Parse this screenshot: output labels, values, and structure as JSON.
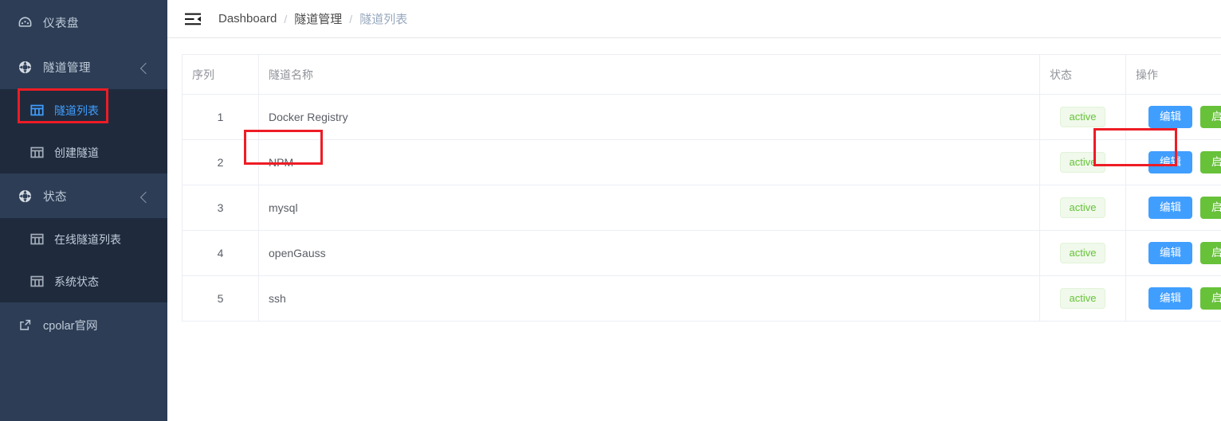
{
  "sidebar": {
    "items": [
      {
        "label": "仪表盘",
        "icon": "dashboard-gauge-icon",
        "type": "item"
      },
      {
        "label": "隧道管理",
        "icon": "tunnel-ring-icon",
        "type": "group",
        "arrow": "chevron-up-icon"
      },
      {
        "label": "隧道列表",
        "icon": "grid-table-icon",
        "type": "sub",
        "active": true
      },
      {
        "label": "创建隧道",
        "icon": "grid-table-icon",
        "type": "sub",
        "active": false
      },
      {
        "label": "状态",
        "icon": "tunnel-ring-icon",
        "type": "group",
        "arrow": "chevron-up-icon"
      },
      {
        "label": "在线隧道列表",
        "icon": "grid-table-icon",
        "type": "sub",
        "active": false
      },
      {
        "label": "系统状态",
        "icon": "grid-table-icon",
        "type": "sub",
        "active": false
      }
    ],
    "footer": {
      "label": "cpolar官网",
      "icon": "external-link-icon"
    },
    "colors": {
      "background": "#2d3d55",
      "submenu_background": "#1f2b3d",
      "text": "#bfcbd9",
      "active_text": "#409eff"
    }
  },
  "topbar": {
    "fold_icon": "menu-fold-icon",
    "breadcrumb": [
      {
        "label": "Dashboard",
        "current": false
      },
      {
        "label": "隧道管理",
        "current": false
      },
      {
        "label": "隧道列表",
        "current": true
      }
    ],
    "separator": "/"
  },
  "table": {
    "columns": [
      {
        "key": "index",
        "label": "序列"
      },
      {
        "key": "name",
        "label": "隧道名称"
      },
      {
        "key": "status",
        "label": "状态"
      },
      {
        "key": "ops",
        "label": "操作"
      }
    ],
    "rows": [
      {
        "index": "1",
        "name": "Docker Registry",
        "status": "active"
      },
      {
        "index": "2",
        "name": "NPM",
        "status": "active"
      },
      {
        "index": "3",
        "name": "mysql",
        "status": "active"
      },
      {
        "index": "4",
        "name": "openGauss",
        "status": "active"
      },
      {
        "index": "5",
        "name": "ssh",
        "status": "active"
      }
    ],
    "buttons": {
      "edit": "编辑",
      "start": "启动"
    },
    "colors": {
      "edit_button": "#409eff",
      "start_button": "#67c23a",
      "badge_text": "#67c23a",
      "badge_background": "#f0f9eb",
      "badge_border": "#e1f3d8",
      "border": "#ebeef5",
      "header_text": "#909399"
    }
  },
  "annotations": {
    "color": "#ee1c25",
    "boxes": [
      {
        "name": "sidebar-tunnel-list-highlight"
      },
      {
        "name": "npm-name-cell-highlight"
      },
      {
        "name": "npm-edit-button-highlight"
      }
    ]
  }
}
